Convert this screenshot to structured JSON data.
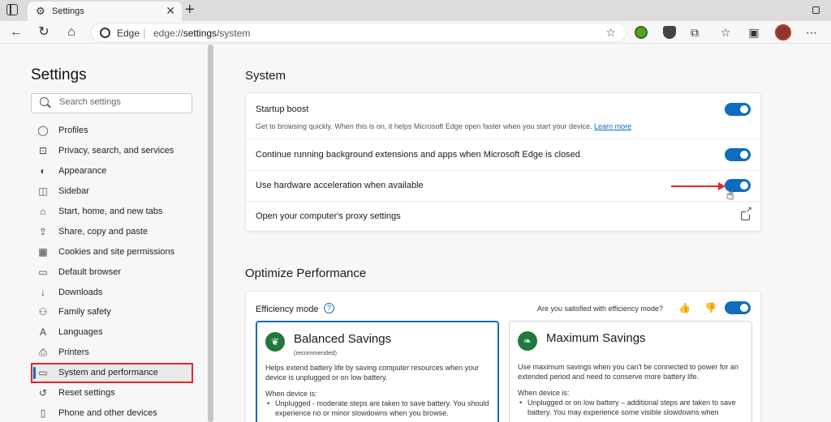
{
  "tab": {
    "title": "Settings"
  },
  "address": {
    "site": "Edge",
    "url_prefix": "edge://",
    "url_path": "settings",
    "url_suffix": "/system"
  },
  "sidebar": {
    "title": "Settings",
    "search_placeholder": "Search settings",
    "items": [
      {
        "label": "Profiles",
        "icon": "profile-icon"
      },
      {
        "label": "Privacy, search, and services",
        "icon": "lock-icon"
      },
      {
        "label": "Appearance",
        "icon": "palette-icon"
      },
      {
        "label": "Sidebar",
        "icon": "sidebar-icon"
      },
      {
        "label": "Start, home, and new tabs",
        "icon": "home-icon"
      },
      {
        "label": "Share, copy and paste",
        "icon": "share-icon"
      },
      {
        "label": "Cookies and site permissions",
        "icon": "cookie-icon"
      },
      {
        "label": "Default browser",
        "icon": "browser-icon"
      },
      {
        "label": "Downloads",
        "icon": "download-icon"
      },
      {
        "label": "Family safety",
        "icon": "family-icon"
      },
      {
        "label": "Languages",
        "icon": "language-icon"
      },
      {
        "label": "Printers",
        "icon": "printer-icon"
      },
      {
        "label": "System and performance",
        "icon": "laptop-icon"
      },
      {
        "label": "Reset settings",
        "icon": "reset-icon"
      },
      {
        "label": "Phone and other devices",
        "icon": "phone-icon"
      }
    ]
  },
  "system": {
    "heading": "System",
    "startup_boost": "Startup boost",
    "startup_desc": "Get to browsing quickly. When this is on, it helps Microsoft Edge open faster when you start your device.",
    "learn_more": "Learn more",
    "background": "Continue running background extensions and apps when Microsoft Edge is closed",
    "hardware": "Use hardware acceleration when available",
    "proxy": "Open your computer's proxy settings"
  },
  "performance": {
    "heading": "Optimize Performance",
    "efficiency_mode": "Efficiency mode",
    "satisfied": "Are you satisfied with efficiency mode?",
    "balanced": {
      "name": "Balanced Savings",
      "tag": "(recommended)",
      "desc": "Helps extend battery life by saving computer resources when your device is unplugged or on low battery.",
      "when": "When device is:",
      "bullet1": "Unplugged - moderate steps are taken to save battery. You should experience no or minor slowdowns when you browse."
    },
    "maximum": {
      "name": "Maximum Savings",
      "desc": "Use maximum savings when you can't be connected to power for an extended period and need to conserve more battery life.",
      "when": "When device is:",
      "bullet1": "Unplugged or on low battery – additional steps are taken to save battery. You may experience some visible slowdowns when"
    }
  },
  "colors": {
    "accent": "#0f6cbd",
    "highlight": "#e3262a"
  }
}
